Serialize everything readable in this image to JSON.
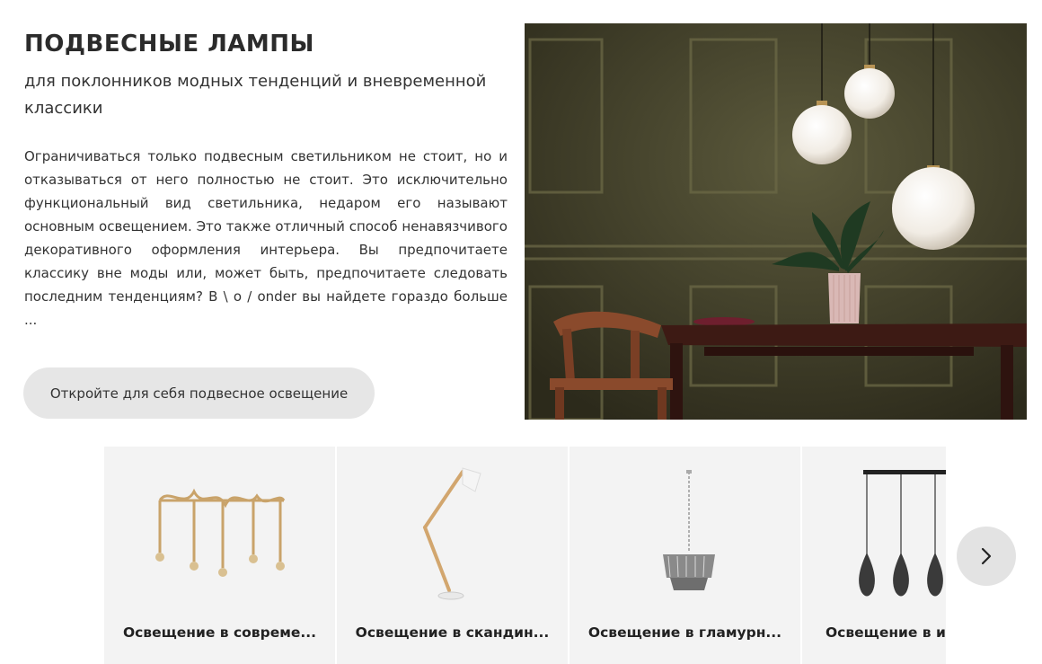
{
  "hero": {
    "title": "ПОДВЕСНЫЕ ЛАМПЫ",
    "subtitle": "для поклонников модных тенденций и вневременной классики",
    "body": "Ограничиваться только подвесным светильником не стоит, но и отказываться от него полностью не стоит. Это исключительно функциональный вид светильника, недаром его называют основным освещением. Это также отличный способ ненавязчивого декоративного оформления интерьера. Вы предпочитаете классику вне моды или, может быть, предпочитаете следовать последним тенденциям? В \\ o / onder вы найдете гораздо больше ...",
    "cta_label": "Откройте для себя подвесное освещение"
  },
  "carousel": {
    "items": [
      {
        "label": "Освещение в совреме..."
      },
      {
        "label": "Освещение в скандин..."
      },
      {
        "label": "Освещение в гламурн..."
      },
      {
        "label": "Освещение в ин"
      }
    ],
    "next_icon": "chevron-right-icon"
  }
}
